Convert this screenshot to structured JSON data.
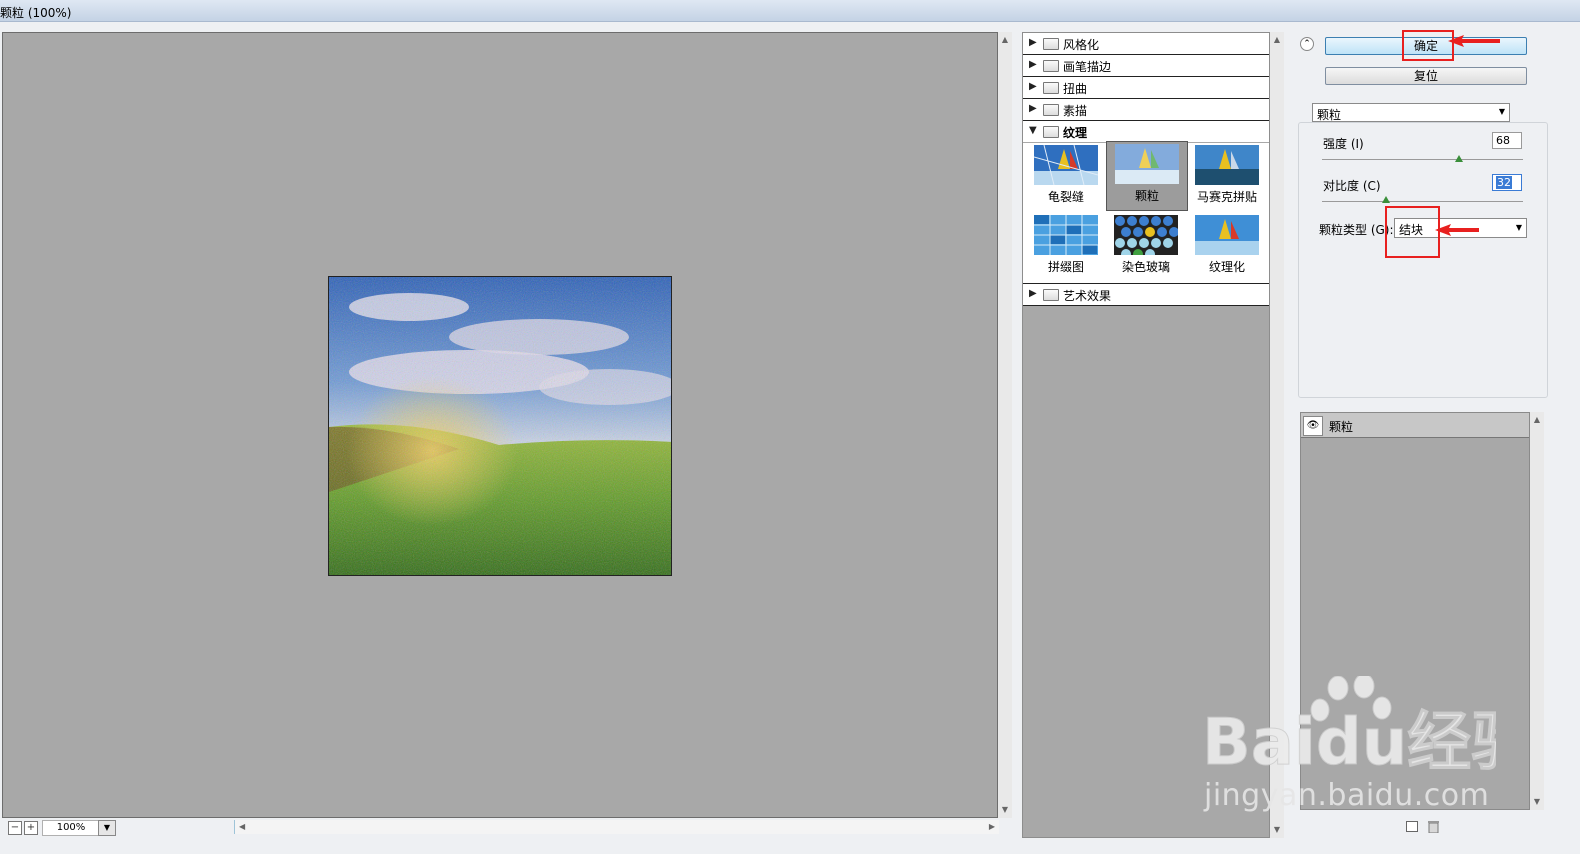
{
  "window": {
    "title": "颗粒 (100%)"
  },
  "preview": {
    "zoom": "100%"
  },
  "gallery": {
    "categories": [
      {
        "label": "风格化",
        "expanded": false
      },
      {
        "label": "画笔描边",
        "expanded": false
      },
      {
        "label": "扭曲",
        "expanded": false
      },
      {
        "label": "素描",
        "expanded": false
      },
      {
        "label": "纹理",
        "expanded": true
      },
      {
        "label": "艺术效果",
        "expanded": false
      }
    ],
    "texture_filters": [
      {
        "label": "龟裂缝",
        "selected": false
      },
      {
        "label": "颗粒",
        "selected": true
      },
      {
        "label": "马赛克拼贴",
        "selected": false
      },
      {
        "label": "拼缀图",
        "selected": false
      },
      {
        "label": "染色玻璃",
        "selected": false
      },
      {
        "label": "纹理化",
        "selected": false
      }
    ]
  },
  "panel": {
    "ok_label": "确定",
    "reset_label": "复位",
    "filter_selected": "颗粒",
    "intensity": {
      "label": "强度 (I)",
      "value": "68",
      "level": 68
    },
    "contrast": {
      "label": "对比度 (C)",
      "value": "32",
      "level": 32
    },
    "grain_type": {
      "label": "颗粒类型 (G):",
      "value": "结块"
    }
  },
  "layers": {
    "items": [
      {
        "name": "颗粒",
        "visible": true
      }
    ]
  },
  "watermark": {
    "text": "jingyan.baidu.com",
    "logo_text": "Baidu经验"
  },
  "colors": {
    "annotation": "#e8201f",
    "preview_bg": "#a8a8a8",
    "ok_button": "#bfe3f7"
  }
}
